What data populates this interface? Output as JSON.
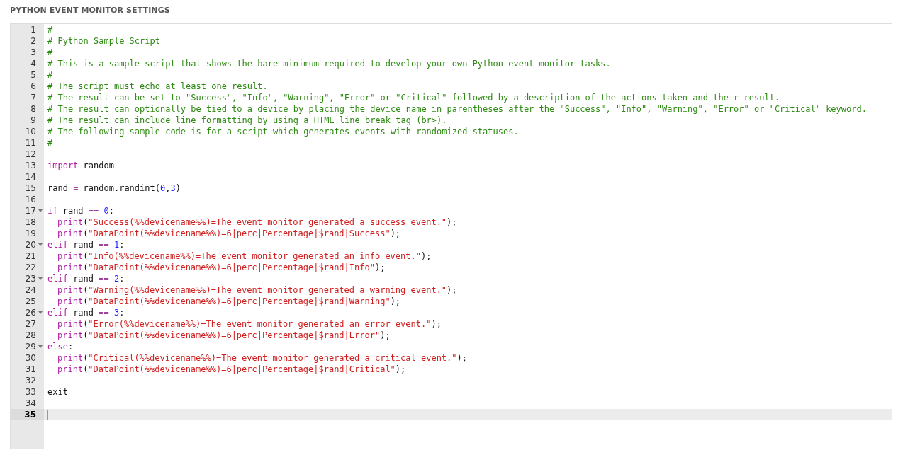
{
  "title": "PYTHON EVENT MONITOR SETTINGS",
  "editor": {
    "lines": [
      {
        "number": "1",
        "fold": false,
        "selected": false,
        "indented": false,
        "tokens": [
          {
            "kind": "comment",
            "text": "#"
          }
        ]
      },
      {
        "number": "2",
        "fold": false,
        "selected": false,
        "indented": false,
        "tokens": [
          {
            "kind": "comment",
            "text": "# Python Sample Script"
          }
        ]
      },
      {
        "number": "3",
        "fold": false,
        "selected": false,
        "indented": false,
        "tokens": [
          {
            "kind": "comment",
            "text": "#"
          }
        ]
      },
      {
        "number": "4",
        "fold": false,
        "selected": false,
        "indented": false,
        "tokens": [
          {
            "kind": "comment",
            "text": "# This is a sample script that shows the bare minimum required to develop your own Python event monitor tasks."
          }
        ]
      },
      {
        "number": "5",
        "fold": false,
        "selected": false,
        "indented": false,
        "tokens": [
          {
            "kind": "comment",
            "text": "#"
          }
        ]
      },
      {
        "number": "6",
        "fold": false,
        "selected": false,
        "indented": false,
        "tokens": [
          {
            "kind": "comment",
            "text": "# The script must echo at least one result."
          }
        ]
      },
      {
        "number": "7",
        "fold": false,
        "selected": false,
        "indented": false,
        "tokens": [
          {
            "kind": "comment",
            "text": "# The result can be set to \"Success\", \"Info\", \"Warning\", \"Error\" or \"Critical\" followed by a description of the actions taken and their result."
          }
        ]
      },
      {
        "number": "8",
        "fold": false,
        "selected": false,
        "indented": false,
        "tokens": [
          {
            "kind": "comment",
            "text": "# The result can optionally be tied to a device by placing the device name in parentheses after the \"Success\", \"Info\", \"Warning\", \"Error\" or \"Critical\" keyword."
          }
        ]
      },
      {
        "number": "9",
        "fold": false,
        "selected": false,
        "indented": false,
        "tokens": [
          {
            "kind": "comment",
            "text": "# The result can include line formatting by using a HTML line break tag (br>)."
          }
        ]
      },
      {
        "number": "10",
        "fold": false,
        "selected": false,
        "indented": false,
        "tokens": [
          {
            "kind": "comment",
            "text": "# The following sample code is for a script which generates events with randomized statuses."
          }
        ]
      },
      {
        "number": "11",
        "fold": false,
        "selected": false,
        "indented": false,
        "tokens": [
          {
            "kind": "comment",
            "text": "#"
          }
        ]
      },
      {
        "number": "12",
        "fold": false,
        "selected": false
      },
      {
        "number": "13",
        "fold": false,
        "selected": false,
        "indented": false,
        "tokens": [
          {
            "kind": "keyword",
            "text": "import"
          },
          {
            "kind": "plain",
            "text": " random"
          }
        ]
      },
      {
        "number": "14",
        "fold": false,
        "selected": false
      },
      {
        "number": "15",
        "fold": false,
        "selected": false,
        "indented": false,
        "tokens": [
          {
            "kind": "plain",
            "text": "rand "
          },
          {
            "kind": "operator",
            "text": "="
          },
          {
            "kind": "plain",
            "text": " random.randint("
          },
          {
            "kind": "number",
            "text": "0"
          },
          {
            "kind": "plain",
            "text": ","
          },
          {
            "kind": "number",
            "text": "3"
          },
          {
            "kind": "plain",
            "text": ")"
          }
        ]
      },
      {
        "number": "16",
        "fold": false,
        "selected": false
      },
      {
        "number": "17",
        "fold": true,
        "selected": false,
        "indented": false,
        "tokens": [
          {
            "kind": "keyword",
            "text": "if"
          },
          {
            "kind": "plain",
            "text": " rand"
          },
          {
            "kind": "operator",
            "text": " == "
          },
          {
            "kind": "number",
            "text": "0"
          },
          {
            "kind": "plain",
            "text": ":"
          }
        ]
      },
      {
        "number": "18",
        "fold": false,
        "selected": false,
        "indented": true,
        "tokens": [
          {
            "kind": "keyword",
            "text": "print"
          },
          {
            "kind": "plain",
            "text": "("
          },
          {
            "kind": "string",
            "text": "\"Success(%%devicename%%)=The event monitor generated a success event.\""
          },
          {
            "kind": "plain",
            "text": ");"
          }
        ]
      },
      {
        "number": "19",
        "fold": false,
        "selected": false,
        "indented": true,
        "tokens": [
          {
            "kind": "keyword",
            "text": "print"
          },
          {
            "kind": "plain",
            "text": "("
          },
          {
            "kind": "string",
            "text": "\"DataPoint(%%devicename%%)=6|perc|Percentage|$rand|Success\""
          },
          {
            "kind": "plain",
            "text": ");"
          }
        ]
      },
      {
        "number": "20",
        "fold": true,
        "selected": false,
        "indented": false,
        "tokens": [
          {
            "kind": "keyword",
            "text": "elif"
          },
          {
            "kind": "plain",
            "text": " rand"
          },
          {
            "kind": "operator",
            "text": " == "
          },
          {
            "kind": "number",
            "text": "1"
          },
          {
            "kind": "plain",
            "text": ":"
          }
        ]
      },
      {
        "number": "21",
        "fold": false,
        "selected": false,
        "indented": true,
        "tokens": [
          {
            "kind": "keyword",
            "text": "print"
          },
          {
            "kind": "plain",
            "text": "("
          },
          {
            "kind": "string",
            "text": "\"Info(%%devicename%%)=The event monitor generated an info event.\""
          },
          {
            "kind": "plain",
            "text": ");"
          }
        ]
      },
      {
        "number": "22",
        "fold": false,
        "selected": false,
        "indented": true,
        "tokens": [
          {
            "kind": "keyword",
            "text": "print"
          },
          {
            "kind": "plain",
            "text": "("
          },
          {
            "kind": "string",
            "text": "\"DataPoint(%%devicename%%)=6|perc|Percentage|$rand|Info\""
          },
          {
            "kind": "plain",
            "text": ");"
          }
        ]
      },
      {
        "number": "23",
        "fold": true,
        "selected": false,
        "indented": false,
        "tokens": [
          {
            "kind": "keyword",
            "text": "elif"
          },
          {
            "kind": "plain",
            "text": " rand"
          },
          {
            "kind": "operator",
            "text": " == "
          },
          {
            "kind": "number",
            "text": "2"
          },
          {
            "kind": "plain",
            "text": ":"
          }
        ]
      },
      {
        "number": "24",
        "fold": false,
        "selected": false,
        "indented": true,
        "tokens": [
          {
            "kind": "keyword",
            "text": "print"
          },
          {
            "kind": "plain",
            "text": "("
          },
          {
            "kind": "string",
            "text": "\"Warning(%%devicename%%)=The event monitor generated a warning event.\""
          },
          {
            "kind": "plain",
            "text": ");"
          }
        ]
      },
      {
        "number": "25",
        "fold": false,
        "selected": false,
        "indented": true,
        "tokens": [
          {
            "kind": "keyword",
            "text": "print"
          },
          {
            "kind": "plain",
            "text": "("
          },
          {
            "kind": "string",
            "text": "\"DataPoint(%%devicename%%)=6|perc|Percentage|$rand|Warning\""
          },
          {
            "kind": "plain",
            "text": ");"
          }
        ]
      },
      {
        "number": "26",
        "fold": true,
        "selected": false,
        "indented": false,
        "tokens": [
          {
            "kind": "keyword",
            "text": "elif"
          },
          {
            "kind": "plain",
            "text": " rand"
          },
          {
            "kind": "operator",
            "text": " == "
          },
          {
            "kind": "number",
            "text": "3"
          },
          {
            "kind": "plain",
            "text": ":"
          }
        ]
      },
      {
        "number": "27",
        "fold": false,
        "selected": false,
        "indented": true,
        "tokens": [
          {
            "kind": "keyword",
            "text": "print"
          },
          {
            "kind": "plain",
            "text": "("
          },
          {
            "kind": "string",
            "text": "\"Error(%%devicename%%)=The event monitor generated an error event.\""
          },
          {
            "kind": "plain",
            "text": ");"
          }
        ]
      },
      {
        "number": "28",
        "fold": false,
        "selected": false,
        "indented": true,
        "tokens": [
          {
            "kind": "keyword",
            "text": "print"
          },
          {
            "kind": "plain",
            "text": "("
          },
          {
            "kind": "string",
            "text": "\"DataPoint(%%devicename%%)=6|perc|Percentage|$rand|Error\""
          },
          {
            "kind": "plain",
            "text": ");"
          }
        ]
      },
      {
        "number": "29",
        "fold": true,
        "selected": false,
        "indented": false,
        "tokens": [
          {
            "kind": "keyword",
            "text": "else"
          },
          {
            "kind": "plain",
            "text": ":"
          }
        ]
      },
      {
        "number": "30",
        "fold": false,
        "selected": false,
        "indented": true,
        "tokens": [
          {
            "kind": "keyword",
            "text": "print"
          },
          {
            "kind": "plain",
            "text": "("
          },
          {
            "kind": "string",
            "text": "\"Critical(%%devicename%%)=The event monitor generated a critical event.\""
          },
          {
            "kind": "plain",
            "text": ");"
          }
        ]
      },
      {
        "number": "31",
        "fold": false,
        "selected": false,
        "indented": true,
        "tokens": [
          {
            "kind": "keyword",
            "text": "print"
          },
          {
            "kind": "plain",
            "text": "("
          },
          {
            "kind": "string",
            "text": "\"DataPoint(%%devicename%%)=6|perc|Percentage|$rand|Critical\""
          },
          {
            "kind": "plain",
            "text": ");"
          }
        ]
      },
      {
        "number": "32",
        "fold": false,
        "selected": false
      },
      {
        "number": "33",
        "fold": false,
        "selected": false,
        "indented": false,
        "tokens": [
          {
            "kind": "plain",
            "text": "exit"
          }
        ]
      },
      {
        "number": "34",
        "fold": false,
        "selected": false
      },
      {
        "number": "35",
        "fold": false,
        "selected": true
      }
    ]
  }
}
